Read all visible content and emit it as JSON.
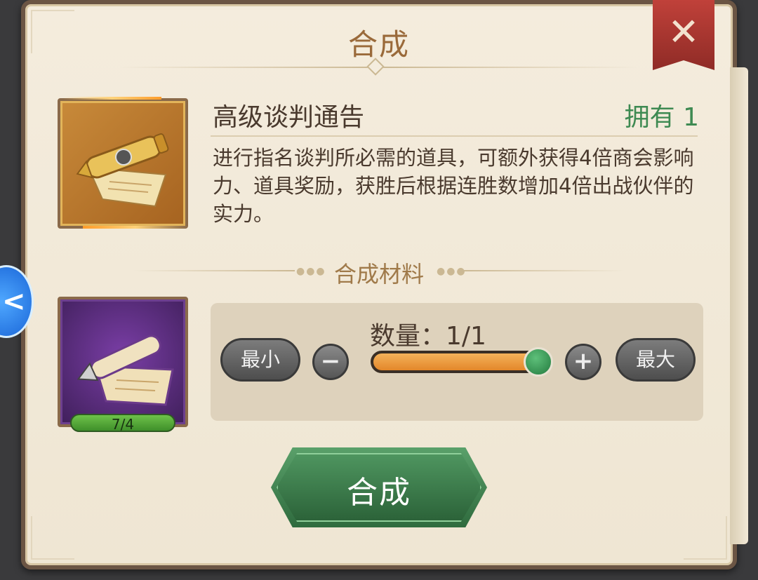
{
  "dialog": {
    "title": "合成",
    "close_icon": "✕"
  },
  "item": {
    "name": "高级谈判通告",
    "owned": "拥有 1",
    "description": "进行指名谈判所必需的道具，可额外获得4倍商会影响力、道具奖励，获胜后根据连胜数增加4倍出战伙伴的实力。",
    "icon": "golden-scroll-icon"
  },
  "materials": {
    "section_title": "合成材料",
    "material_icon": "purple-scroll-icon",
    "count": "7/4"
  },
  "quantity": {
    "label": "数量：1/1",
    "min_label": "最小",
    "max_label": "最大",
    "minus_icon": "−",
    "plus_icon": "+",
    "slider_fraction": 1.0
  },
  "action": {
    "craft_label": "合成"
  },
  "side_tab": {
    "icon": "<"
  },
  "colors": {
    "title": "#9a6a3a",
    "owned": "#3e8a52",
    "craft_button": "#3f8550",
    "slider_fill": "#e8962e"
  }
}
